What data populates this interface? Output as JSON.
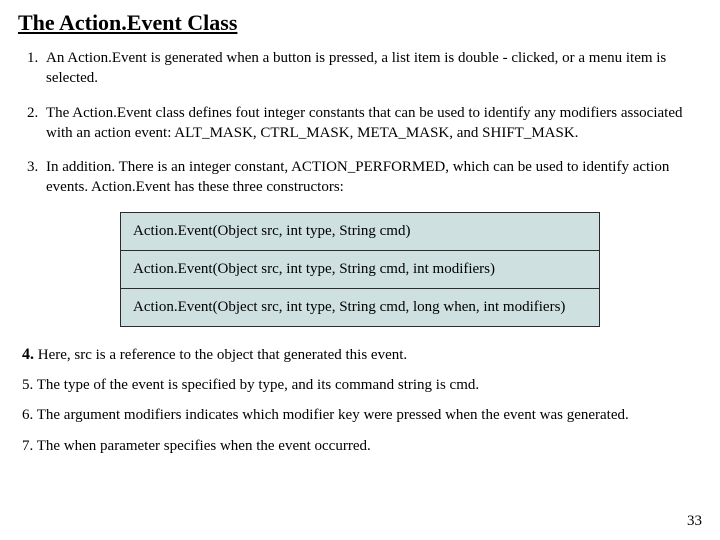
{
  "title": "The Action.Event Class",
  "list": {
    "item1": "An Action.Event is generated when a button is pressed, a list item is double -  clicked, or a menu item is selected.",
    "item2": "The Action.Event class defines fout integer constants that can be used to identify any modifiers associated with an action event: ALT_MASK, CTRL_MASK, META_MASK, and SHIFT_MASK.",
    "item3": "In addition. There is an integer constant, ACTION_PERFORMED, which can be used to identify action events. Action.Event has these three constructors:"
  },
  "constructors": {
    "c1": "Action.Event(Object src, int type, String cmd)",
    "c2": "Action.Event(Object src, int type, String cmd, int modifiers)",
    "c3": "Action.Event(Object src, int type, String cmd, long when, int modifiers)"
  },
  "tail": {
    "n4": "4.",
    "t4": " Here, src is a reference to the object that generated this event.",
    "n5": "5.",
    "t5": " The type of the event is specified by type, and its command string is cmd.",
    "n6": "6.",
    "t6": " The argument modifiers indicates which modifier key were pressed when the event was generated.",
    "n7": "7.",
    "t7": " The when parameter specifies when the event occurred."
  },
  "pagenum": "33"
}
